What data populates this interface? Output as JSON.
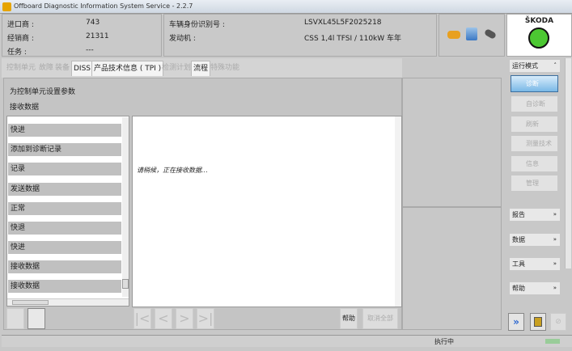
{
  "window": {
    "title": "Offboard Diagnostic Information System Service - 2.2.7"
  },
  "header": {
    "importer_label": "进口商 :",
    "importer_value": "743",
    "dealer_label": "经销商 :",
    "dealer_value": "21311",
    "order_label": "任务 :",
    "order_value": "---",
    "vin_label": "车辆身份识别号 :",
    "vin_value": "LSVXL45L5F2025218",
    "engine_label": "发动机 :",
    "engine_value": "CSS 1,4l TFSI / 110kW 车年",
    "brand": "ŠKODA"
  },
  "tabs": [
    {
      "label": "控制单元",
      "active": false
    },
    {
      "label": "故障",
      "active": false
    },
    {
      "label": "装备",
      "active": false
    },
    {
      "label": "DISS",
      "active": true
    },
    {
      "label": "产品技术信息 ( TPI )",
      "active": true
    },
    {
      "label": "检测计划",
      "active": false
    },
    {
      "label": "流程",
      "active": true
    },
    {
      "label": "特殊功能",
      "active": false
    }
  ],
  "main": {
    "heading1": "为控制单元设置参数",
    "heading2": "接收数据",
    "steps": [
      "快进",
      "添加到诊断记录",
      "记录",
      "发送数据",
      "正常",
      "快退",
      "快进",
      "接收数据",
      "接收数据"
    ],
    "message": "请稍候，正在接收数据…",
    "help_button": "帮助",
    "cancel_all_button": "取消全部"
  },
  "right_panel": {
    "mode_header": "运行模式",
    "modes": [
      {
        "label": "诊断",
        "active": true
      },
      {
        "label": "自诊断"
      },
      {
        "label": "刷新"
      },
      {
        "label": "测量技术"
      },
      {
        "label": "信息"
      },
      {
        "label": "管理"
      }
    ],
    "sections": [
      "报告",
      "数据",
      "工具",
      "帮助"
    ]
  },
  "status": {
    "text": "执行中"
  }
}
